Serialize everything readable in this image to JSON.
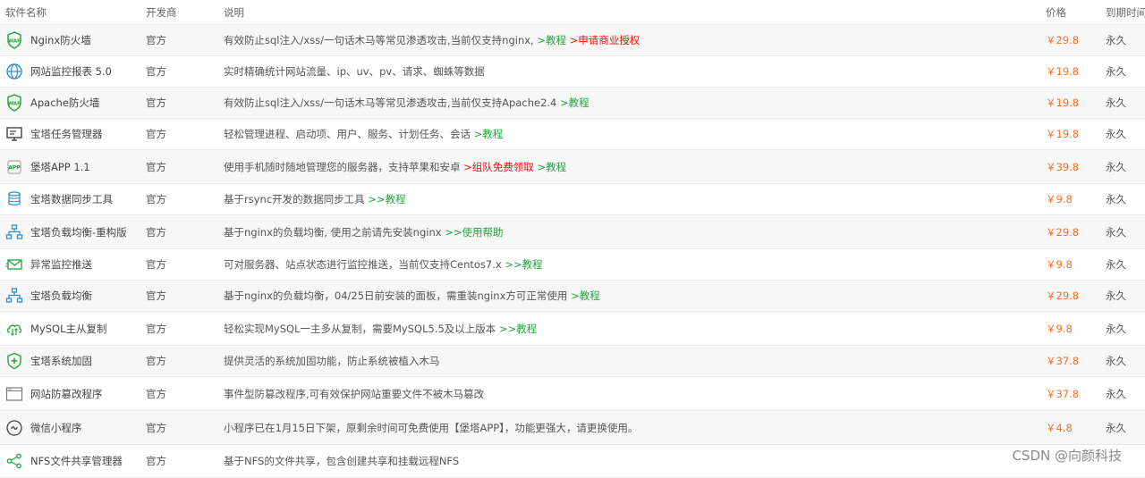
{
  "header": {
    "name": "软件名称",
    "developer": "开发商",
    "description": "说明",
    "price": "价格",
    "expire": "到期时间"
  },
  "rows": [
    {
      "icon": "waf-icon",
      "name": "Nginx防火墙",
      "developer": "官方",
      "desc": "有效防止sql注入/xss/一句话木马等常见渗透攻击,当前仅支持nginx,",
      "link1": ">教程",
      "link2": ">申请商业授权",
      "price": "￥29.8",
      "expire": "永久"
    },
    {
      "icon": "globe-monitor-icon",
      "name": "网站监控报表 5.0",
      "developer": "官方",
      "desc": "实时精确统计网站流量、ip、uv、pv、请求、蜘蛛等数据",
      "price": "￥19.8",
      "expire": "永久"
    },
    {
      "icon": "waf-icon",
      "name": "Apache防火墙",
      "developer": "官方",
      "desc": "有效防止sql注入/xss/一句话木马等常见渗透攻击,当前仅支持Apache2.4",
      "link1": ">教程",
      "price": "￥19.8",
      "expire": "永久"
    },
    {
      "icon": "task-manager-icon",
      "name": "宝塔任务管理器",
      "developer": "官方",
      "desc": "轻松管理进程、启动项、用户、服务、计划任务、会话",
      "link1": ">教程",
      "price": "￥19.8",
      "expire": "永久"
    },
    {
      "icon": "app-icon",
      "name": "堡塔APP 1.1",
      "developer": "官方",
      "desc": "使用手机随时随地管理您的服务器，支持苹果和安卓",
      "link_red": ">组队免费领取",
      "link1": ">教程",
      "price": "￥39.8",
      "expire": "永久"
    },
    {
      "icon": "data-sync-icon",
      "name": "宝塔数据同步工具",
      "developer": "官方",
      "desc": "基于rsync开发的数据同步工具",
      "link1": ">>教程",
      "price": "￥9.8",
      "expire": "永久"
    },
    {
      "icon": "load-balance-icon",
      "name": "宝塔负载均衡-重构版",
      "developer": "官方",
      "desc": "基于nginx的负载均衡, 使用之前请先安装nginx",
      "link1": ">>使用帮助",
      "price": "￥29.8",
      "expire": "永久"
    },
    {
      "icon": "mail-push-icon",
      "name": "异常监控推送",
      "developer": "官方",
      "desc": "可对服务器、站点状态进行监控推送，当前仅支持Centos7.x",
      "link1": ">>教程",
      "price": "￥9.8",
      "expire": "永久"
    },
    {
      "icon": "load-balance-icon",
      "name": "宝塔负载均衡",
      "developer": "官方",
      "desc": "基于nginx的负载均衡，04/25日前安装的面板，需重装nginx方可正常使用",
      "link1": ">教程",
      "price": "￥29.8",
      "expire": "永久"
    },
    {
      "icon": "mysql-replication-icon",
      "name": "MySQL主从复制",
      "developer": "官方",
      "desc": "轻松实现MySQL一主多从复制，需要MySQL5.5及以上版本",
      "link1": ">>教程",
      "price": "￥9.8",
      "expire": "永久"
    },
    {
      "icon": "shield-icon",
      "name": "宝塔系统加固",
      "developer": "官方",
      "desc": "提供灵活的系统加固功能，防止系统被植入木马",
      "price": "￥37.8",
      "expire": "永久"
    },
    {
      "icon": "tamper-proof-icon",
      "name": "网站防篡改程序",
      "developer": "官方",
      "desc": "事件型防篡改程序,可有效保护网站重要文件不被木马篡改",
      "price": "￥37.8",
      "expire": "永久"
    },
    {
      "icon": "mini-program-icon",
      "name": "微信小程序",
      "developer": "官方",
      "desc": "小程序已在1月15日下架，原剩余时间可免费使用【堡塔APP】，功能更强大，请更换使用。",
      "price": "￥4.8",
      "expire": "永久"
    },
    {
      "icon": "nfs-share-icon",
      "name": "NFS文件共享管理器",
      "developer": "官方",
      "desc": "基于NFS的文件共享，包含创建共享和挂载远程NFS",
      "price": "",
      "expire": ""
    }
  ],
  "watermark": "CSDN @向颜科技",
  "colors": {
    "price": "#fc6d26",
    "link": "#20a53a",
    "link_red": "#f0120a",
    "icon": "#20a53a"
  }
}
